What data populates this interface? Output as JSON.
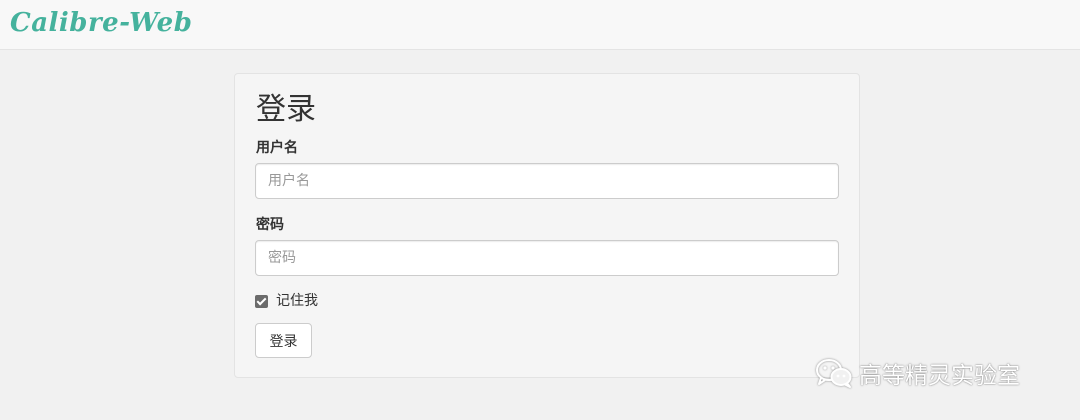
{
  "navbar": {
    "brand": "Calibre-Web"
  },
  "login": {
    "title": "登录",
    "username_label": "用户名",
    "username_placeholder": "用户名",
    "username_value": "",
    "password_label": "密码",
    "password_placeholder": "密码",
    "password_value": "",
    "remember_label": "记住我",
    "remember_checked": true,
    "submit_label": "登录"
  },
  "watermark": {
    "text": "高等精灵实验室",
    "icon": "wechat-icon"
  },
  "colors": {
    "brand": "#45b29d",
    "background": "#f1f1f1",
    "navbar": "#f8f8f8",
    "panel": "#f5f5f5",
    "checkbox": "#6b6b6b"
  }
}
